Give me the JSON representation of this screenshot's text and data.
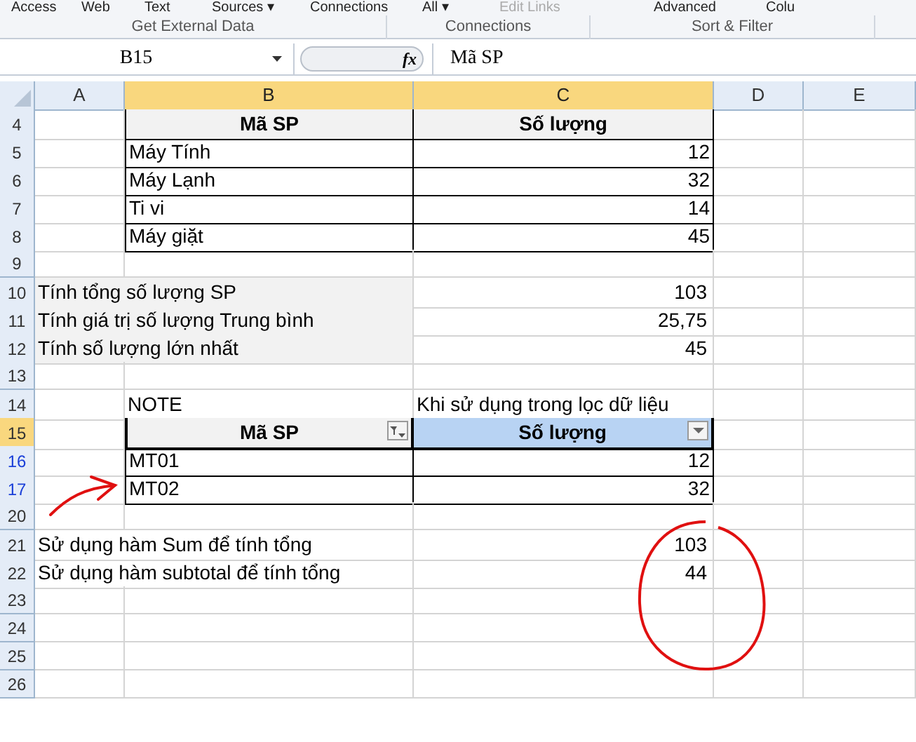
{
  "ribbon": {
    "buttons": [
      {
        "label": "Access",
        "disabled": false
      },
      {
        "label": "Web",
        "disabled": false
      },
      {
        "label": "Text",
        "disabled": false
      },
      {
        "label": "Sources ▾",
        "disabled": false
      },
      {
        "label": "Connections",
        "disabled": false
      },
      {
        "label": "All ▾",
        "disabled": false
      },
      {
        "label": "Edit Links",
        "disabled": true
      },
      {
        "label": "Advanced",
        "disabled": false
      },
      {
        "label": "Colu",
        "disabled": false
      }
    ],
    "groups": [
      "Get External Data",
      "Connections",
      "Sort & Filter"
    ]
  },
  "formula_bar": {
    "name_box": "B15",
    "function_symbol": "fx",
    "formula": "Mã SP"
  },
  "columns": [
    {
      "label": "A",
      "selected": false
    },
    {
      "label": "B",
      "selected": true
    },
    {
      "label": "C",
      "selected": true
    },
    {
      "label": "D",
      "selected": false
    },
    {
      "label": "E",
      "selected": false
    }
  ],
  "rows": [
    {
      "number": "4",
      "kind": "table-header",
      "selected": false,
      "filtered": false,
      "name": "Mã SP",
      "value": "Số lượng"
    },
    {
      "number": "5",
      "kind": "table-row",
      "selected": false,
      "filtered": false,
      "name": "Máy Tính",
      "value": "12"
    },
    {
      "number": "6",
      "kind": "table-row",
      "selected": false,
      "filtered": false,
      "name": "Máy Lạnh",
      "value": "32"
    },
    {
      "number": "7",
      "kind": "table-row",
      "selected": false,
      "filtered": false,
      "name": "Ti vi",
      "value": "14"
    },
    {
      "number": "8",
      "kind": "table-row",
      "selected": false,
      "filtered": false,
      "name": "Máy giặt",
      "value": "45"
    },
    {
      "number": "9",
      "kind": "blank",
      "selected": false,
      "filtered": false
    },
    {
      "number": "10",
      "kind": "summary",
      "selected": false,
      "filtered": false,
      "name": "Tính tổng số lượng SP",
      "value": "103"
    },
    {
      "number": "11",
      "kind": "summary",
      "selected": false,
      "filtered": false,
      "name": "Tính giá trị số lượng Trung bình",
      "value": "25,75"
    },
    {
      "number": "12",
      "kind": "summary",
      "selected": false,
      "filtered": false,
      "name": "Tính số lượng lớn nhất",
      "value": "45"
    },
    {
      "number": "13",
      "kind": "blank",
      "selected": false,
      "filtered": false
    },
    {
      "number": "14",
      "kind": "note",
      "selected": false,
      "filtered": false,
      "name": "NOTE",
      "value": "Khi sử dụng trong lọc dữ liệu"
    },
    {
      "number": "15",
      "kind": "filter-header",
      "selected": true,
      "filtered": false,
      "cells": [
        {
          "text": "Mã SP",
          "filtered": true,
          "selected": false
        },
        {
          "text": "Số lượng",
          "filtered": false,
          "selected": true
        }
      ]
    },
    {
      "number": "16",
      "kind": "table-row",
      "selected": false,
      "filtered": true,
      "name": "MT01",
      "value": "12"
    },
    {
      "number": "17",
      "kind": "table-row",
      "selected": false,
      "filtered": true,
      "name": "MT02",
      "value": "32"
    },
    {
      "number": "20",
      "kind": "blank",
      "selected": false,
      "filtered": false
    },
    {
      "number": "21",
      "kind": "result",
      "selected": false,
      "filtered": false,
      "name": "Sử dụng hàm Sum để tính tổng",
      "value": "103"
    },
    {
      "number": "22",
      "kind": "result",
      "selected": false,
      "filtered": false,
      "name": "Sử dụng hàm subtotal để tính tổng",
      "value": "44"
    },
    {
      "number": "23",
      "kind": "blank",
      "selected": false,
      "filtered": false
    },
    {
      "number": "24",
      "kind": "blank",
      "selected": false,
      "filtered": false
    },
    {
      "number": "25",
      "kind": "blank",
      "selected": false,
      "filtered": false
    },
    {
      "number": "26",
      "kind": "blank",
      "selected": false,
      "filtered": false
    }
  ]
}
